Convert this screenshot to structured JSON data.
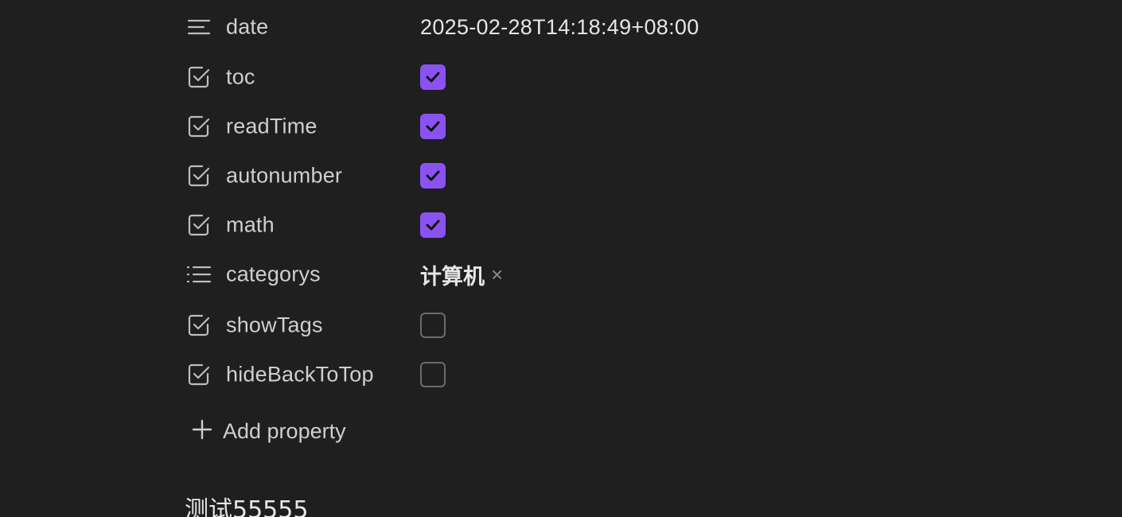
{
  "properties": [
    {
      "key": "date",
      "icon": "text-lines-icon",
      "type": "text",
      "value": "2025-02-28T14:18:49+08:00"
    },
    {
      "key": "toc",
      "icon": "checkbox-property-icon",
      "type": "checkbox",
      "checked": true
    },
    {
      "key": "readTime",
      "icon": "checkbox-property-icon",
      "type": "checkbox",
      "checked": true
    },
    {
      "key": "autonumber",
      "icon": "checkbox-property-icon",
      "type": "checkbox",
      "checked": true
    },
    {
      "key": "math",
      "icon": "checkbox-property-icon",
      "type": "checkbox",
      "checked": true
    },
    {
      "key": "categorys",
      "icon": "list-icon",
      "type": "list",
      "tags": [
        "计算机"
      ]
    },
    {
      "key": "showTags",
      "icon": "checkbox-property-icon",
      "type": "checkbox",
      "checked": false
    },
    {
      "key": "hideBackToTop",
      "icon": "checkbox-property-icon",
      "type": "checkbox",
      "checked": false
    }
  ],
  "add_property": {
    "label": "Add property",
    "icon": "plus-icon"
  },
  "tag_remove_glyph": "×",
  "document": {
    "heading": "测试55555"
  },
  "colors": {
    "background": "#1f1f1f",
    "accent": "#8b52f2",
    "text": "#cfcfcf"
  }
}
